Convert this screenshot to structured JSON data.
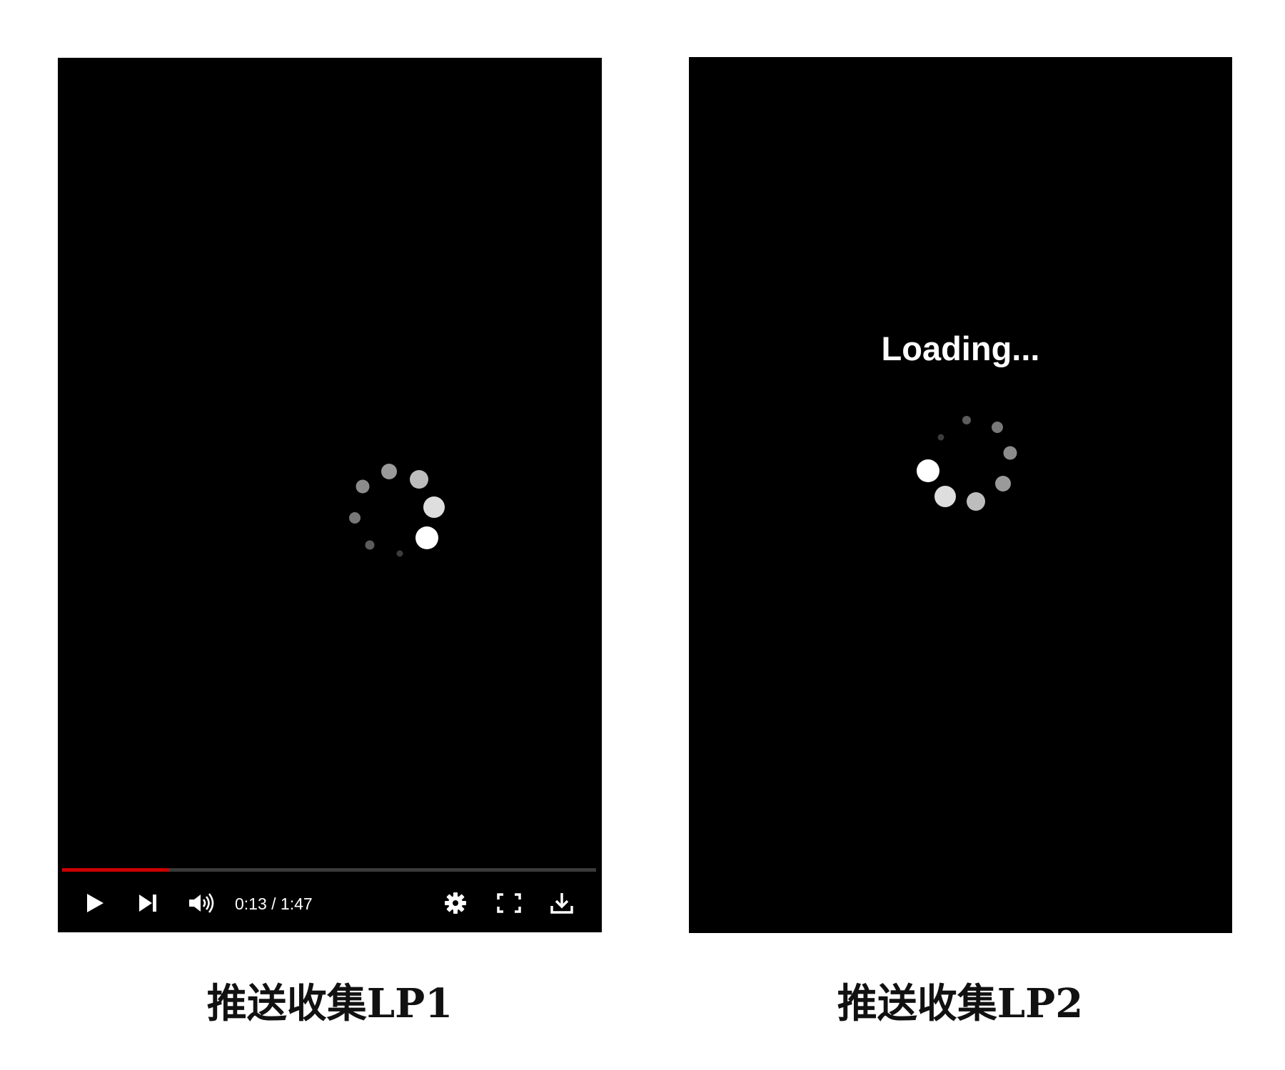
{
  "panels": [
    {
      "caption": "推送收集LP1",
      "player": {
        "progress_fraction": 0.2,
        "progress_color": "#cc0000",
        "time": "0:13 / 1:47",
        "icons": [
          "play-icon",
          "skip-next-icon",
          "volume-icon",
          "settings-gear-icon",
          "fullscreen-icon",
          "download-icon"
        ]
      }
    },
    {
      "caption": "推送收集LP2",
      "loading_text": "Loading..."
    }
  ]
}
